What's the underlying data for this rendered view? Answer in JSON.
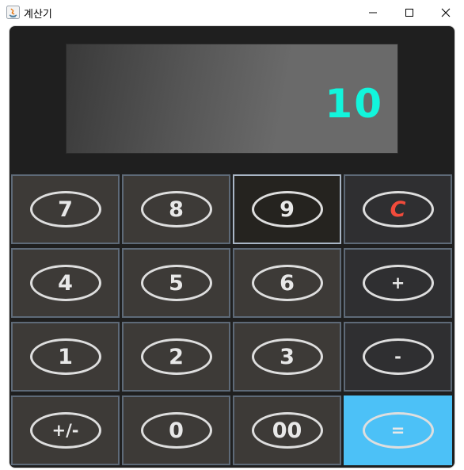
{
  "window": {
    "title": "계산기"
  },
  "display": {
    "value": "10"
  },
  "keys": {
    "k7": "7",
    "k8": "8",
    "k9": "9",
    "clear": "C",
    "k4": "4",
    "k5": "5",
    "k6": "6",
    "plus": "+",
    "k1": "1",
    "k2": "2",
    "k3": "3",
    "minus": "-",
    "sign": "+/-",
    "k0": "0",
    "k00": "00",
    "equals": "="
  },
  "colors": {
    "display_text": "#12f5dc",
    "clear_text": "#f24b3b",
    "equals_bg": "#4cc1f7"
  }
}
